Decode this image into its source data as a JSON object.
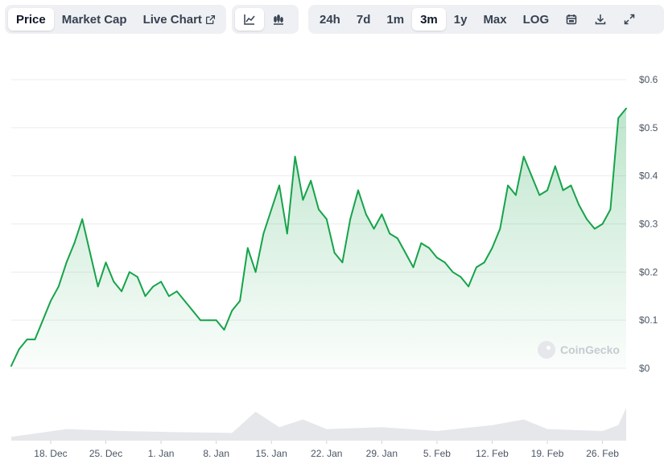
{
  "toolbar": {
    "tabs": [
      {
        "label": "Price",
        "active": true
      },
      {
        "label": "Market Cap",
        "active": false
      },
      {
        "label": "Live Chart",
        "active": false
      }
    ],
    "chart_types": [
      {
        "icon": "line-chart-icon",
        "active": true
      },
      {
        "icon": "candlestick-chart-icon",
        "active": false
      }
    ],
    "ranges": [
      {
        "label": "24h",
        "active": false
      },
      {
        "label": "7d",
        "active": false
      },
      {
        "label": "1m",
        "active": false
      },
      {
        "label": "3m",
        "active": true
      },
      {
        "label": "1y",
        "active": false
      },
      {
        "label": "Max",
        "active": false
      },
      {
        "label": "LOG",
        "active": false
      }
    ],
    "actions": [
      "calendar-icon",
      "download-icon",
      "expand-icon"
    ]
  },
  "watermark": "CoinGecko",
  "colors": {
    "line": "#16a34a",
    "fill": "#16a34a",
    "grid": "#ececec",
    "volume": "#e5e7eb",
    "axis_text": "#4b5563"
  },
  "chart_data": {
    "type": "line",
    "y_axis_position": "right",
    "grid": true,
    "ylim": [
      0,
      0.6
    ],
    "y_ticks": [
      0,
      0.1,
      0.2,
      0.3,
      0.4,
      0.5,
      0.6
    ],
    "y_tick_labels": [
      "$0",
      "$0.1",
      "$0.2",
      "$0.3",
      "$0.4",
      "$0.5",
      "$0.6"
    ],
    "x_tick_labels": [
      "18. Dec",
      "25. Dec",
      "1. Jan",
      "8. Jan",
      "15. Jan",
      "22. Jan",
      "29. Jan",
      "5. Feb",
      "12. Feb",
      "19. Feb",
      "26. Feb"
    ],
    "x_range": [
      "2023-12-13",
      "2024-02-29"
    ],
    "series": [
      {
        "x": [
          "2023-12-13",
          "2023-12-14",
          "2023-12-15",
          "2023-12-16",
          "2023-12-17",
          "2023-12-18",
          "2023-12-19",
          "2023-12-20",
          "2023-12-21",
          "2023-12-22",
          "2023-12-23",
          "2023-12-24",
          "2023-12-25",
          "2023-12-26",
          "2023-12-27",
          "2023-12-28",
          "2023-12-29",
          "2023-12-30",
          "2023-12-31",
          "2024-01-01",
          "2024-01-02",
          "2024-01-03",
          "2024-01-04",
          "2024-01-05",
          "2024-01-06",
          "2024-01-07",
          "2024-01-08",
          "2024-01-09",
          "2024-01-10",
          "2024-01-11",
          "2024-01-12",
          "2024-01-13",
          "2024-01-14",
          "2024-01-15",
          "2024-01-16",
          "2024-01-17",
          "2024-01-18",
          "2024-01-19",
          "2024-01-20",
          "2024-01-21",
          "2024-01-22",
          "2024-01-23",
          "2024-01-24",
          "2024-01-25",
          "2024-01-26",
          "2024-01-27",
          "2024-01-28",
          "2024-01-29",
          "2024-01-30",
          "2024-01-31",
          "2024-02-01",
          "2024-02-02",
          "2024-02-03",
          "2024-02-04",
          "2024-02-05",
          "2024-02-06",
          "2024-02-07",
          "2024-02-08",
          "2024-02-09",
          "2024-02-10",
          "2024-02-11",
          "2024-02-12",
          "2024-02-13",
          "2024-02-14",
          "2024-02-15",
          "2024-02-16",
          "2024-02-17",
          "2024-02-18",
          "2024-02-19",
          "2024-02-20",
          "2024-02-21",
          "2024-02-22",
          "2024-02-23",
          "2024-02-24",
          "2024-02-25",
          "2024-02-26",
          "2024-02-27",
          "2024-02-28",
          "2024-02-29"
        ],
        "values": [
          0.005,
          0.04,
          0.06,
          0.06,
          0.1,
          0.14,
          0.17,
          0.22,
          0.26,
          0.31,
          0.24,
          0.17,
          0.22,
          0.18,
          0.16,
          0.2,
          0.19,
          0.15,
          0.17,
          0.18,
          0.15,
          0.16,
          0.14,
          0.12,
          0.1,
          0.1,
          0.1,
          0.08,
          0.12,
          0.14,
          0.25,
          0.2,
          0.28,
          0.33,
          0.38,
          0.28,
          0.44,
          0.35,
          0.39,
          0.33,
          0.31,
          0.24,
          0.22,
          0.31,
          0.37,
          0.32,
          0.29,
          0.32,
          0.28,
          0.27,
          0.24,
          0.21,
          0.26,
          0.25,
          0.23,
          0.22,
          0.2,
          0.19,
          0.17,
          0.21,
          0.22,
          0.25,
          0.29,
          0.38,
          0.36,
          0.44,
          0.4,
          0.36,
          0.37,
          0.42,
          0.37,
          0.38,
          0.34,
          0.31,
          0.29,
          0.3,
          0.33,
          0.52,
          0.54
        ]
      }
    ],
    "volume": {
      "x": [
        "2023-12-13",
        "2023-12-20",
        "2023-12-27",
        "2024-01-03",
        "2024-01-10",
        "2024-01-13",
        "2024-01-16",
        "2024-01-19",
        "2024-01-22",
        "2024-01-29",
        "2024-02-05",
        "2024-02-12",
        "2024-02-16",
        "2024-02-19",
        "2024-02-26",
        "2024-02-28",
        "2024-02-29"
      ],
      "values": [
        0.1,
        0.3,
        0.25,
        0.22,
        0.2,
        0.75,
        0.35,
        0.55,
        0.3,
        0.35,
        0.25,
        0.4,
        0.55,
        0.3,
        0.25,
        0.4,
        0.85
      ]
    }
  }
}
